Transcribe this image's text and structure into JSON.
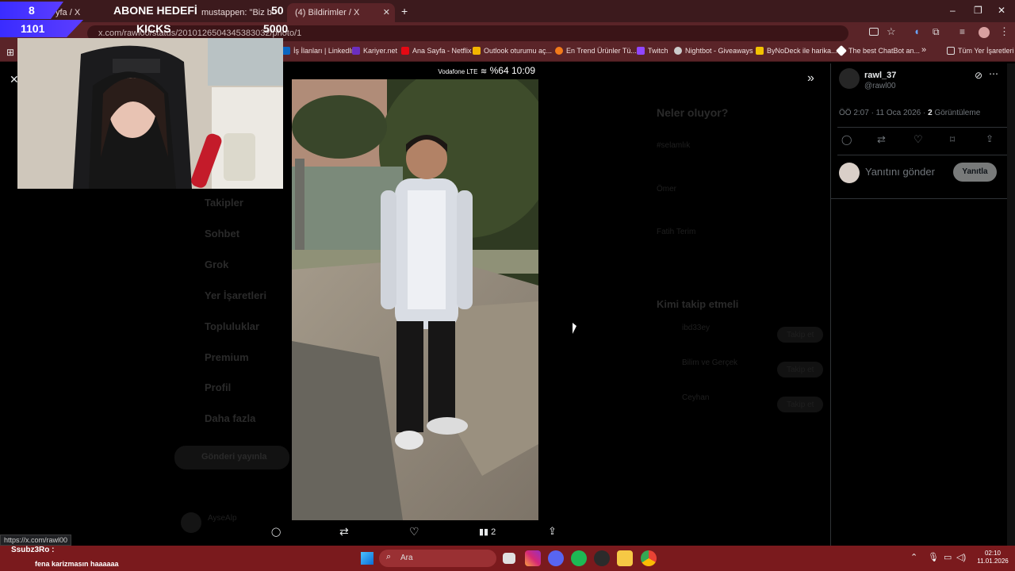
{
  "browser": {
    "tabs": [
      {
        "label": "yfa / X"
      },
      {
        "label": "mustappen: \"Biz bu",
        "active": false
      },
      {
        "label": "(4) Bildirimler / X",
        "active": true
      }
    ],
    "new_tab": "+",
    "url": "x.com/rawl00/status/2010126504345383032/photo/1",
    "win_min": "–",
    "win_max": "❐",
    "win_close": "✕",
    "bookmarks": [
      {
        "label": "İş İlanları | LinkedIn",
        "color": "#0a66c2"
      },
      {
        "label": "Kariyer.net",
        "color": "#6b2fbf"
      },
      {
        "label": "Ana Sayfa - Netflix",
        "color": "#e50914"
      },
      {
        "label": "Outlook oturumu aç...",
        "color": "#f3b400"
      },
      {
        "label": "En Trend Ürünler Tü...",
        "color": "#f27a1a"
      },
      {
        "label": "Twitch",
        "color": "#9146ff"
      },
      {
        "label": "Nightbot - Giveaways",
        "color": "#cccccc"
      },
      {
        "label": "ByNoDeck ile harika...",
        "color": "#f2c200"
      },
      {
        "label": "The best ChatBot an...",
        "color": "#ffffff"
      }
    ],
    "bookmarks_more": "»",
    "all_bookmarks": "Tüm Yer İşaretleri"
  },
  "overlay": {
    "sub_current": "8",
    "sub_title": "ABONE HEDEFİ",
    "sub_goal": "50",
    "kicks_current": "1101",
    "kicks_title": "KICKS",
    "kicks_goal": "5000"
  },
  "x_background": {
    "nav": [
      "Takipler",
      "Sohbet",
      "Grok",
      "Yer İşaretleri",
      "Topluluklar",
      "Premium",
      "Profil",
      "Daha fazla"
    ],
    "post_button": "Gönderi yayınla",
    "account": "AyseAlp",
    "trends_title": "Neler oluyor?",
    "trends": [
      "#selamlık",
      "Ömer",
      "Fatih Terim"
    ],
    "who_to_follow": "Kimi takip etmeli",
    "follow_suggestions": [
      "ibd33ey",
      "Bilim ve Gerçek",
      "Ceyhan"
    ],
    "follow_label": "Takip et"
  },
  "phone_status": {
    "carrier": "Vodafone LTE",
    "battery": "%64",
    "time": "10:09"
  },
  "media_actions": {
    "views": "2"
  },
  "tweet_panel": {
    "display_name": "rawl_37",
    "handle": "@rawl00",
    "timestamp": "ÖÖ 2:07 · 11 Oca 2026",
    "views_count": "2",
    "views_label": "Görüntüleme",
    "reply_placeholder": "Yanıtını gönder",
    "reply_button": "Yanıtla"
  },
  "status_link": "https://x.com/rawl00",
  "chat": {
    "user": "Ssubz3Ro :",
    "message": "fena karizmasın haaaaaa"
  },
  "taskbar": {
    "search_placeholder": "Ara",
    "clock_time": "02:10",
    "clock_date": "11.01.2026"
  }
}
